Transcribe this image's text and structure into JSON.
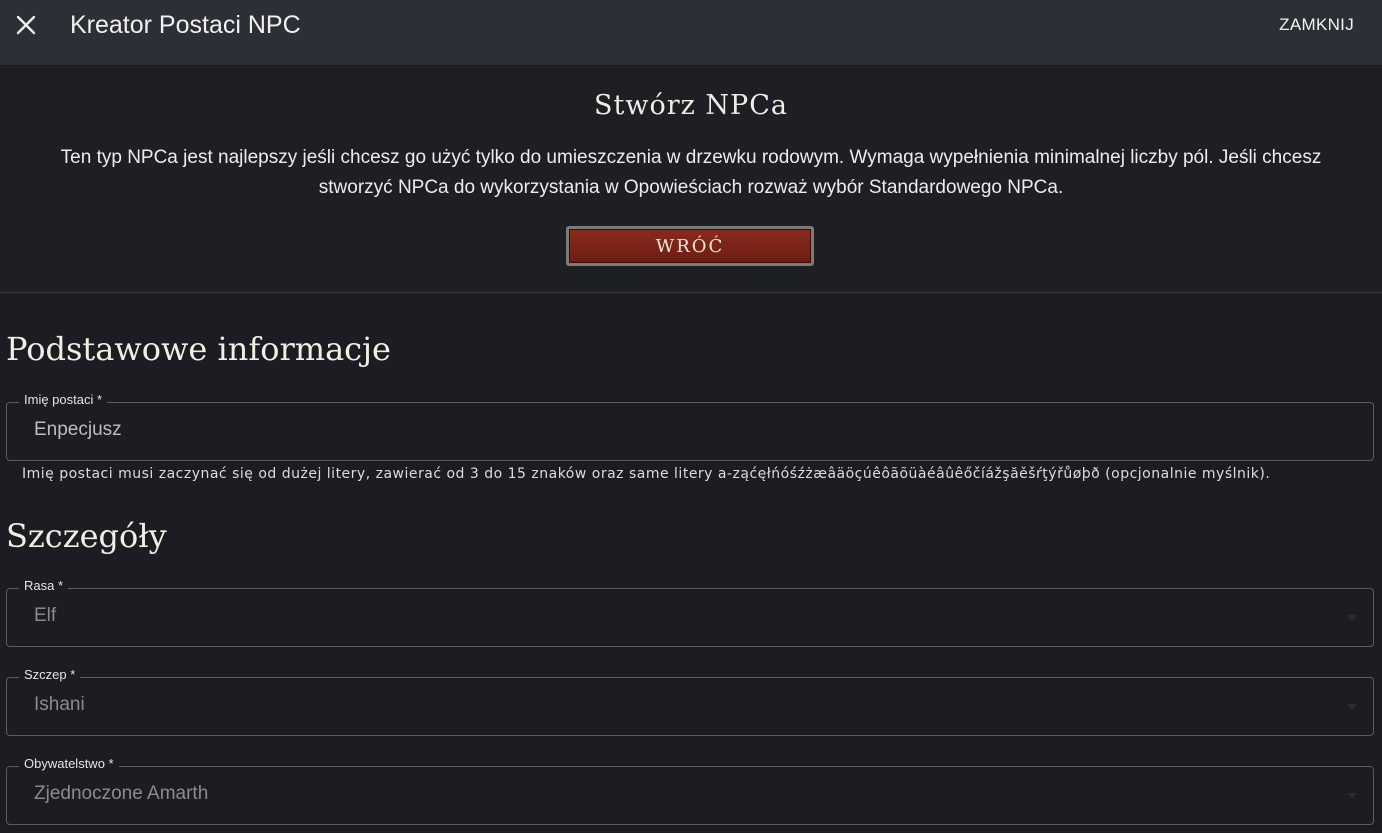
{
  "header": {
    "title": "Kreator Postaci NPC",
    "close_label": "ZAMKNIJ"
  },
  "intro": {
    "title": "Stwórz NPCa",
    "description": "Ten typ NPCa jest najlepszy jeśli chcesz go użyć tylko do umieszczenia w drzewku rodowym. Wymaga wypełnienia minimalnej liczby pól. Jeśli chcesz stworzyć NPCa do wykorzystania w Opowieściach rozważ wybór Standardowego NPCa.",
    "back_label": "WRÓĆ"
  },
  "basic": {
    "heading": "Podstawowe informacje",
    "name_field": {
      "label": "Imię postaci *",
      "value": "Enpecjusz",
      "helper": "Imię postaci musi zaczynać się od dużej litery, zawierać od 3 do 15 znaków oraz same litery a-ząćęłńóśźżæâäöçúêôãõüàéâûêőčíážşăěšŕţýřůøþð (opcjonalnie myślnik)."
    }
  },
  "details": {
    "heading": "Szczegóły",
    "race": {
      "label": "Rasa *",
      "value": "Elf"
    },
    "tribe": {
      "label": "Szczep *",
      "value": "Ishani"
    },
    "citizenship": {
      "label": "Obywatelstwo *",
      "value": "Zjednoczone Amarth"
    }
  },
  "colors": {
    "background": "#1b1d22",
    "topbar": "#2b2f36",
    "accent_button": "#7a2418"
  }
}
